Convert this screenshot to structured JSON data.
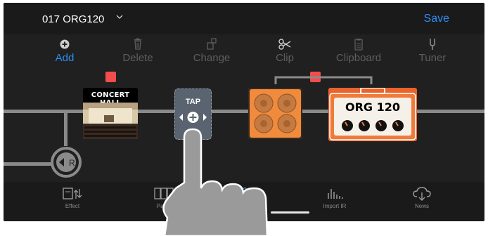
{
  "header": {
    "preset_name": "017 ORG120",
    "save_label": "Save"
  },
  "toolbar": {
    "items": [
      {
        "label": "Add",
        "icon": "plus-circle-icon",
        "active": true
      },
      {
        "label": "Delete",
        "icon": "trash-icon"
      },
      {
        "label": "Change",
        "icon": "change-icon"
      },
      {
        "label": "Clip",
        "icon": "scissors-icon"
      },
      {
        "label": "Clipboard",
        "icon": "clipboard-icon"
      },
      {
        "label": "Tuner",
        "icon": "tuning-fork-icon"
      }
    ]
  },
  "chain": {
    "ir_block_title": "CONCERT HALL",
    "tap_label": "TAP",
    "amp_name": "ORG 120",
    "return_label": "R"
  },
  "bottom_tabs": [
    {
      "label": "Effect",
      "icon": "effect-icon"
    },
    {
      "label": "Patch",
      "icon": "patch-icon"
    },
    {
      "label": "",
      "icon": "sliders-icon"
    },
    {
      "label": "Import IR",
      "icon": "waveform-icon"
    },
    {
      "label": "News",
      "icon": "cloud-download-icon"
    }
  ],
  "colors": {
    "accent": "#2e8df5",
    "red_marker": "#f24d4d",
    "amp_orange": "#e8642c",
    "background": "#202020"
  }
}
